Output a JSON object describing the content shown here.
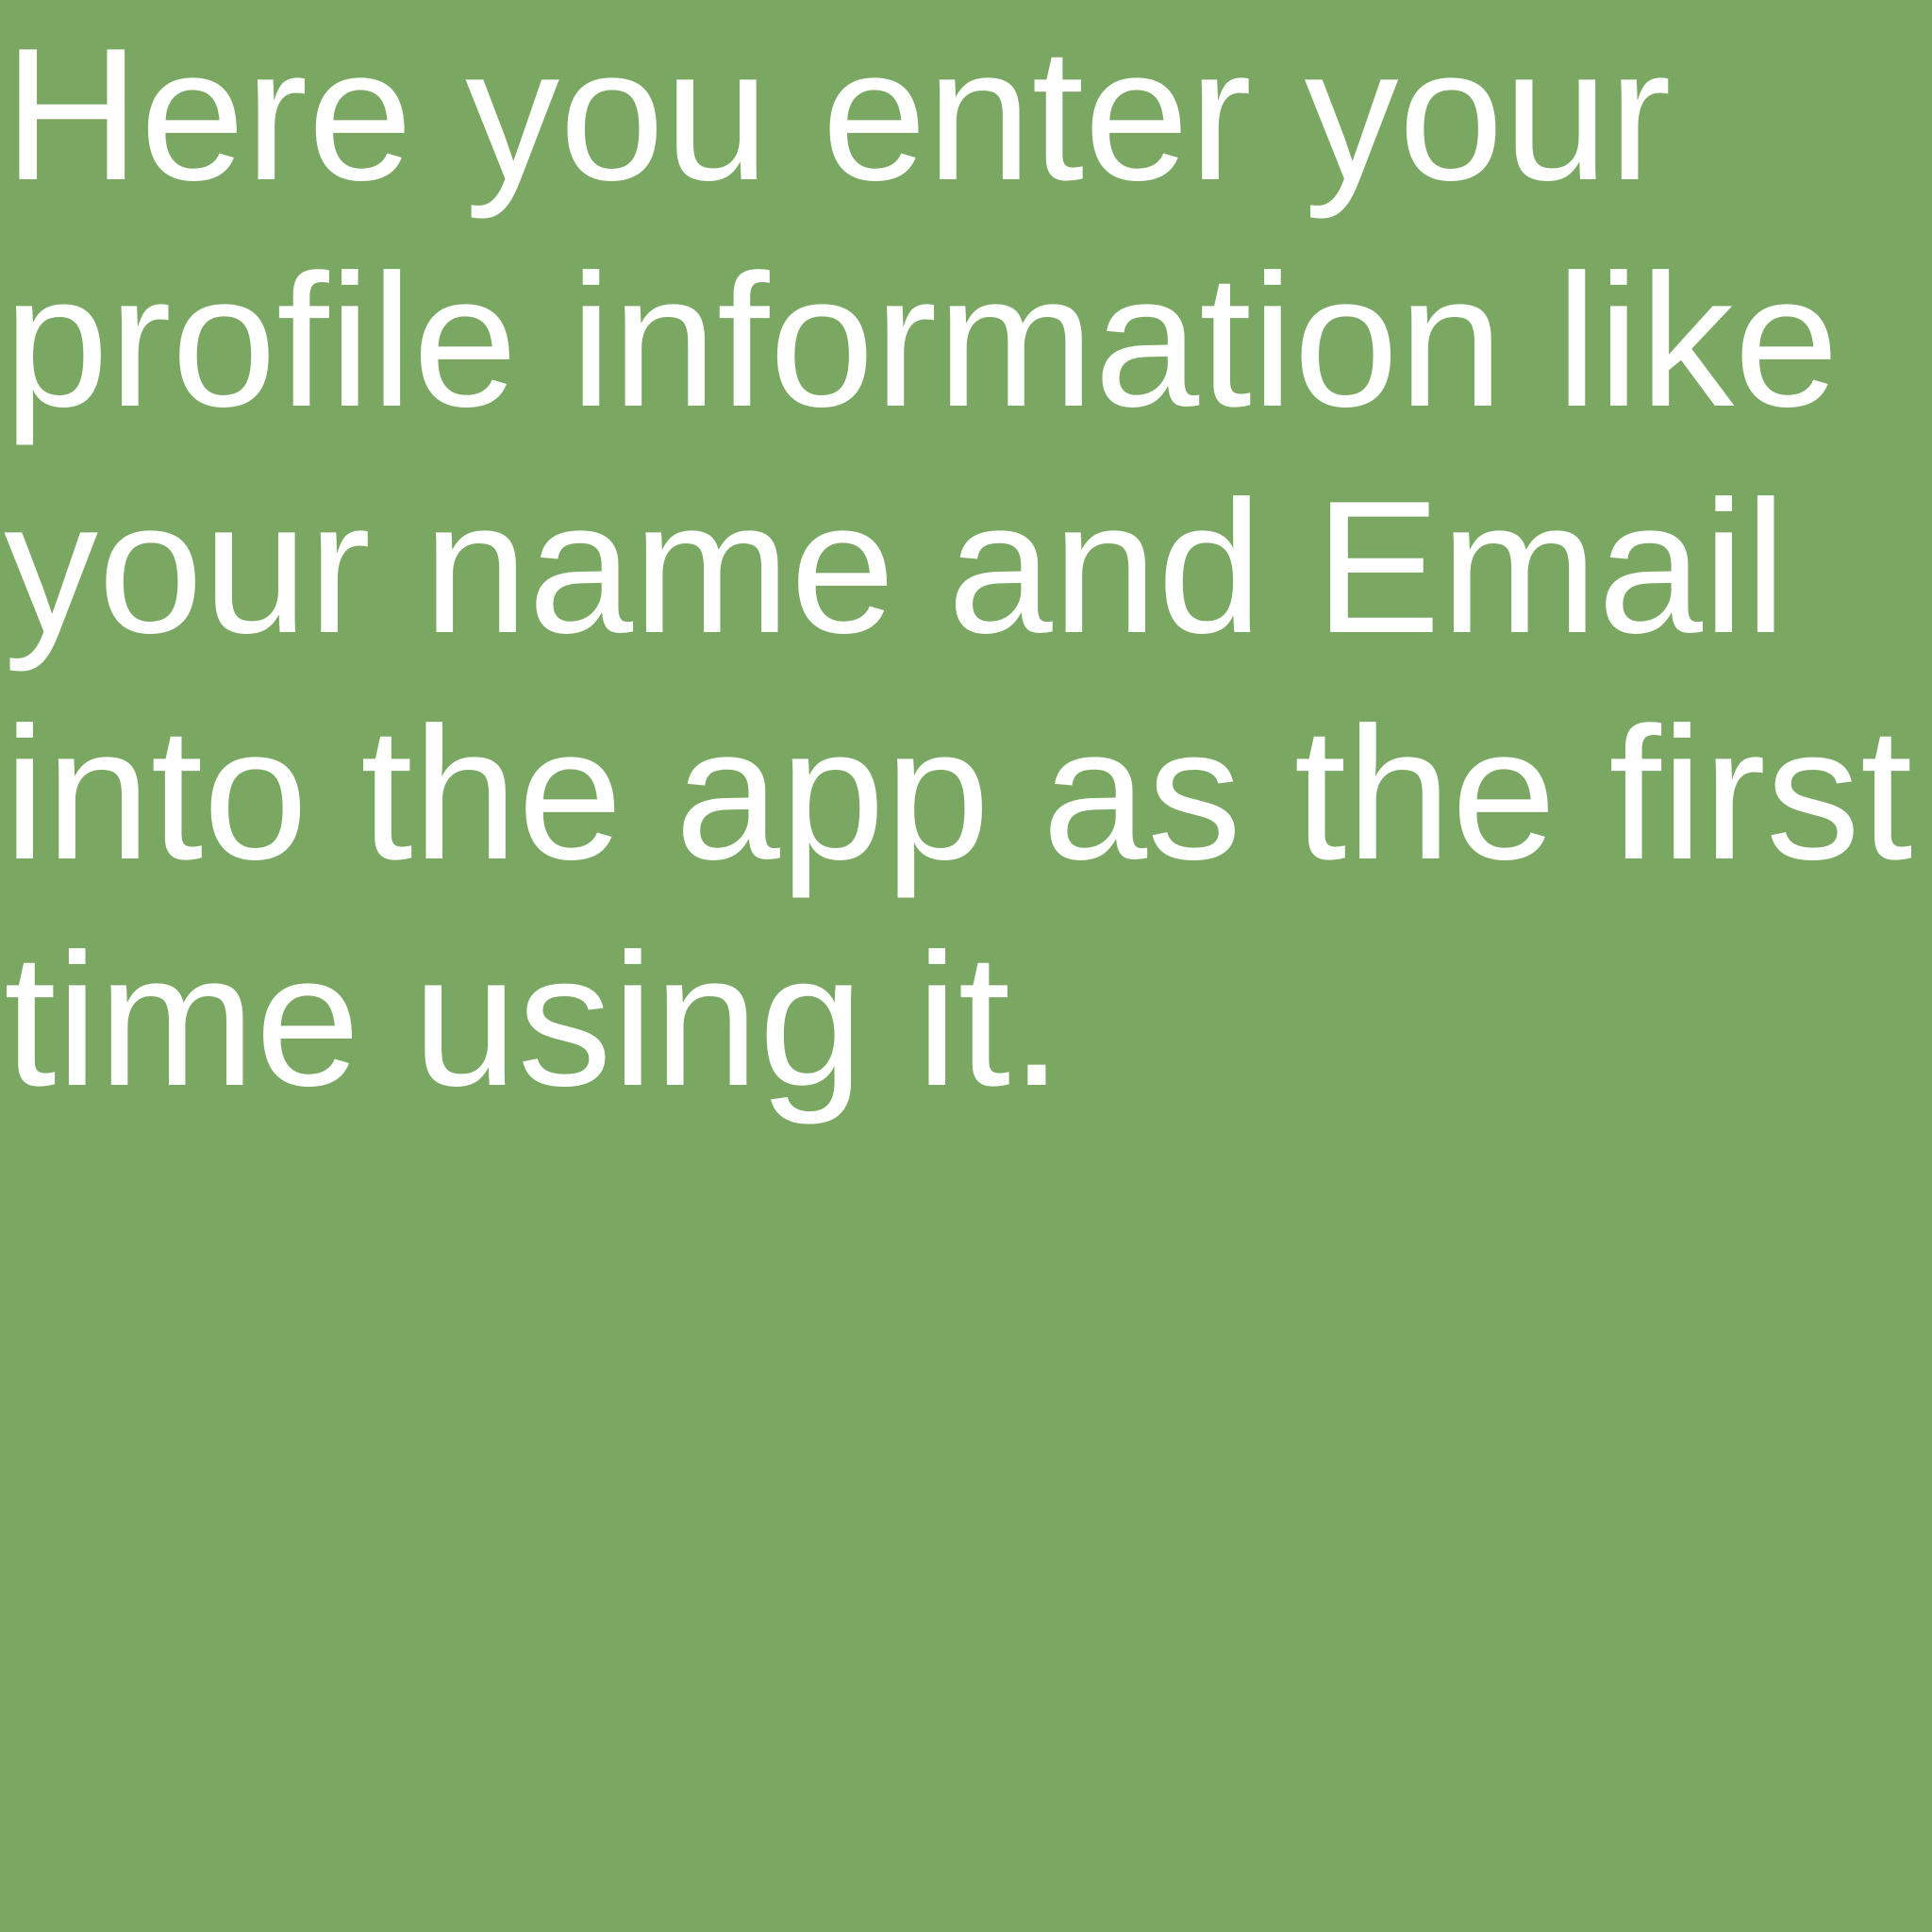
{
  "slide": {
    "background_color": "#7aa862",
    "text_color": "#ffffff",
    "text": "Here you enter your\nprofile information like\nyour name and Email\ninto the app as the first\ntime using it."
  }
}
